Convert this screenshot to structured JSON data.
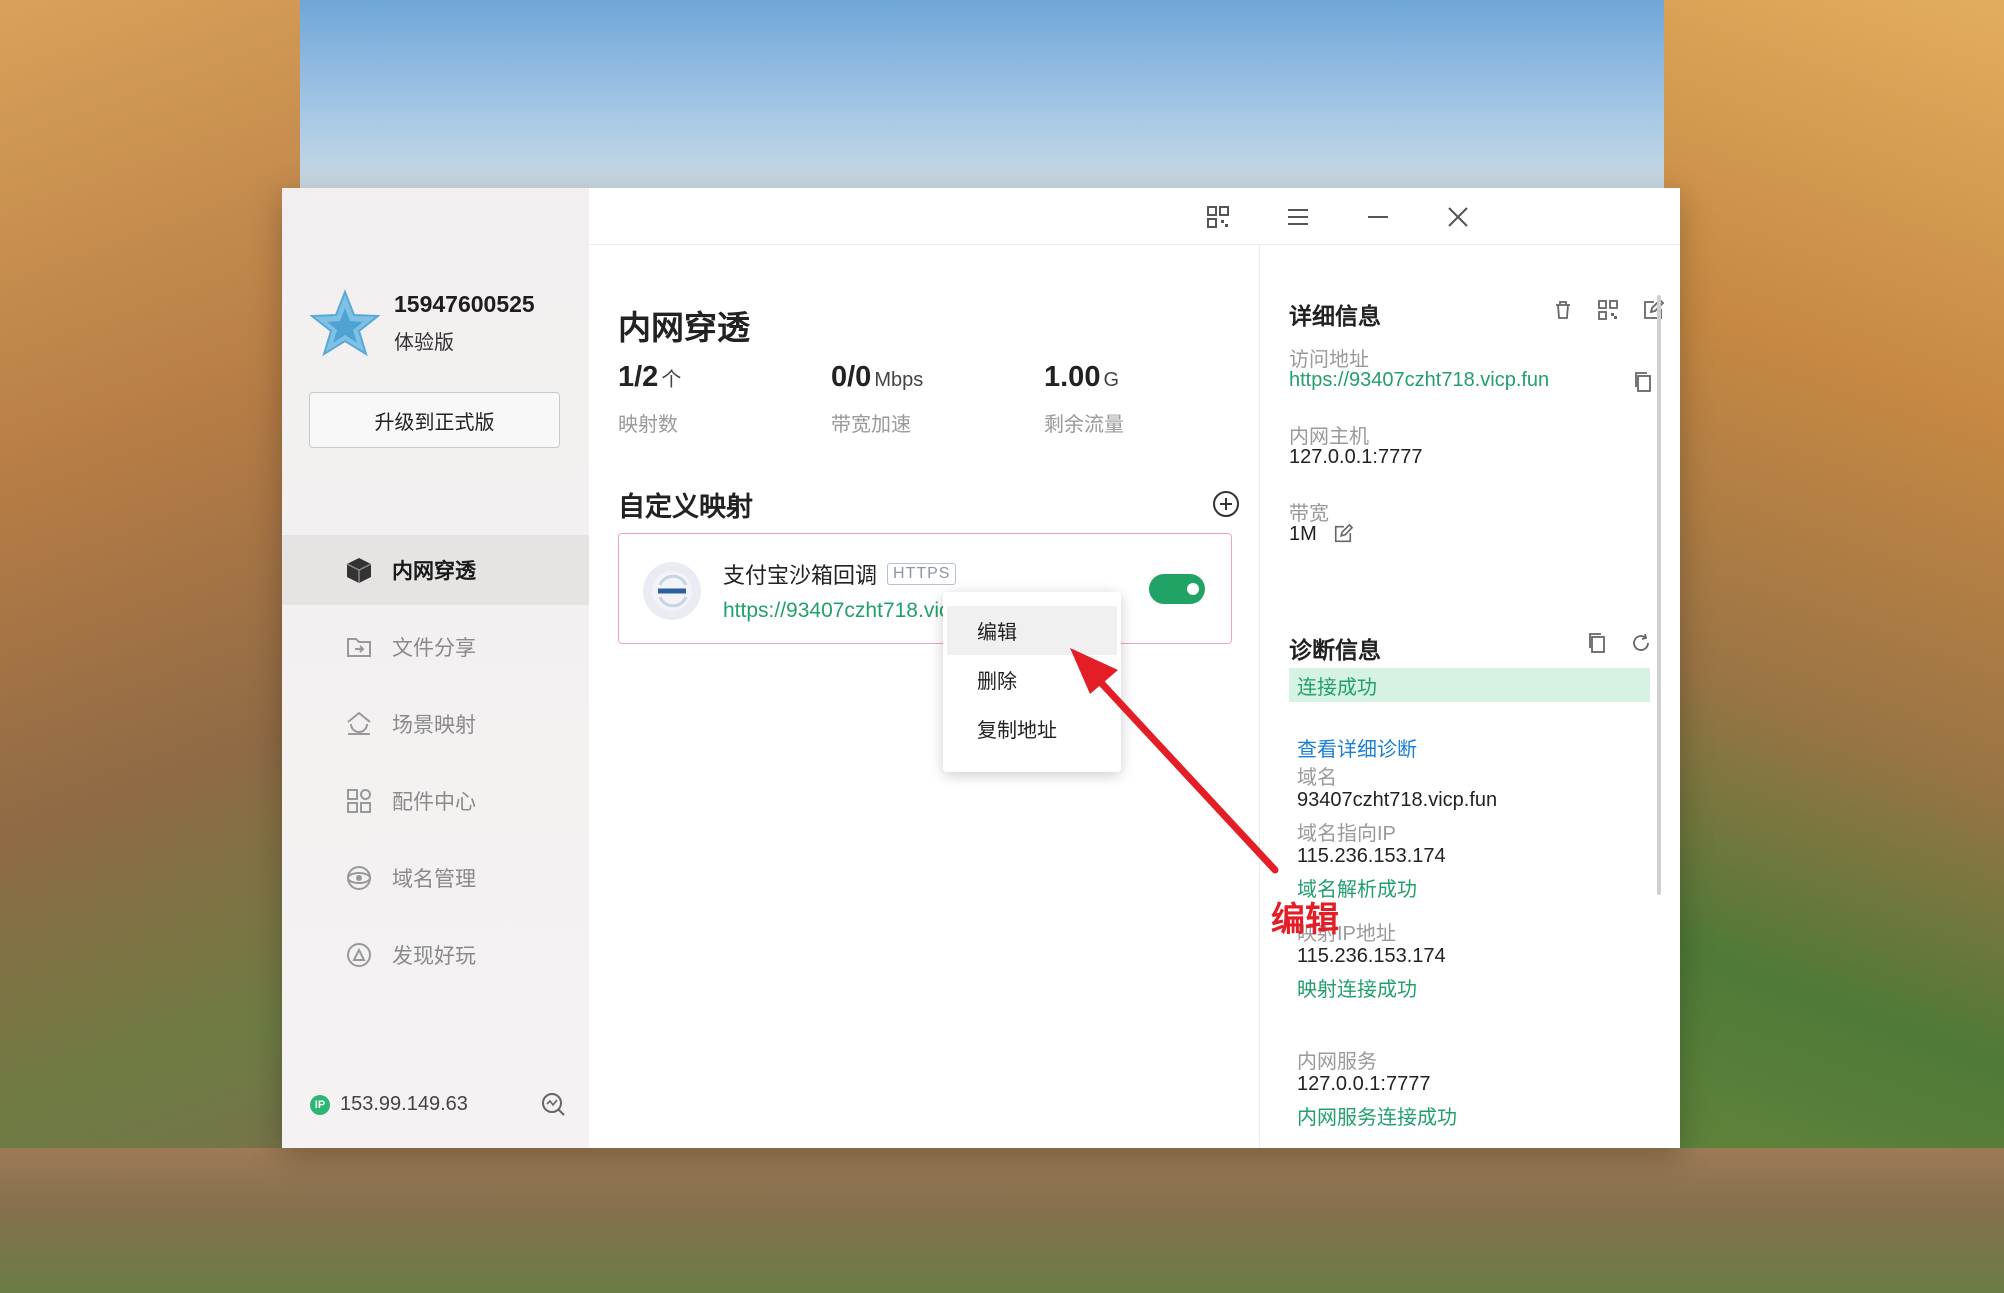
{
  "user": {
    "phone": "15947600525",
    "plan": "体验版",
    "upgrade_label": "升级到正式版"
  },
  "nav": {
    "items": [
      {
        "label": "内网穿透",
        "icon": "cube-icon",
        "active": true
      },
      {
        "label": "文件分享",
        "icon": "folder-share-icon"
      },
      {
        "label": "场景映射",
        "icon": "scene-icon"
      },
      {
        "label": "配件中心",
        "icon": "grid-icon"
      },
      {
        "label": "域名管理",
        "icon": "domain-icon"
      },
      {
        "label": "发现好玩",
        "icon": "discover-icon"
      }
    ]
  },
  "ip": {
    "badge": "IP",
    "address": "153.99.149.63"
  },
  "page": {
    "title": "内网穿透",
    "stats": [
      {
        "value": "1/2",
        "unit": "个",
        "label": "映射数"
      },
      {
        "value": "0/0",
        "unit": "Mbps",
        "label": "带宽加速"
      },
      {
        "value": "1.00",
        "unit": "G",
        "label": "剩余流量"
      }
    ],
    "section_title": "自定义映射"
  },
  "mapping": {
    "name": "支付宝沙箱回调",
    "protocol": "HTTPS",
    "url": "https://93407czht718.vicp.fun",
    "enabled": true
  },
  "context_menu": {
    "items": [
      "编辑",
      "删除",
      "复制地址"
    ]
  },
  "detail": {
    "title": "详细信息",
    "access_label": "访问地址",
    "access_value": "https://93407czht718.vicp.fun",
    "host_label": "内网主机",
    "host_value": "127.0.0.1:7777",
    "bandwidth_label": "带宽",
    "bandwidth_value": "1M"
  },
  "diagnosis": {
    "title": "诊断信息",
    "status": "连接成功",
    "view_detail": "查看详细诊断",
    "domain_label": "域名",
    "domain_value": "93407czht718.vicp.fun",
    "domain_ip_label": "域名指向IP",
    "domain_ip_value": "115.236.153.174",
    "domain_ok": "域名解析成功",
    "map_ip_label": "映射IP地址",
    "map_ip_value": "115.236.153.174",
    "map_ok": "映射连接成功",
    "service_label": "内网服务",
    "service_value": "127.0.0.1:7777",
    "service_ok": "内网服务连接成功"
  },
  "annotation": {
    "text": "编辑"
  },
  "colors": {
    "accent_green": "#22a06b",
    "link_blue": "#1a7fd6",
    "annotation_red": "#e41e26",
    "card_border": "#f2a6b5"
  }
}
